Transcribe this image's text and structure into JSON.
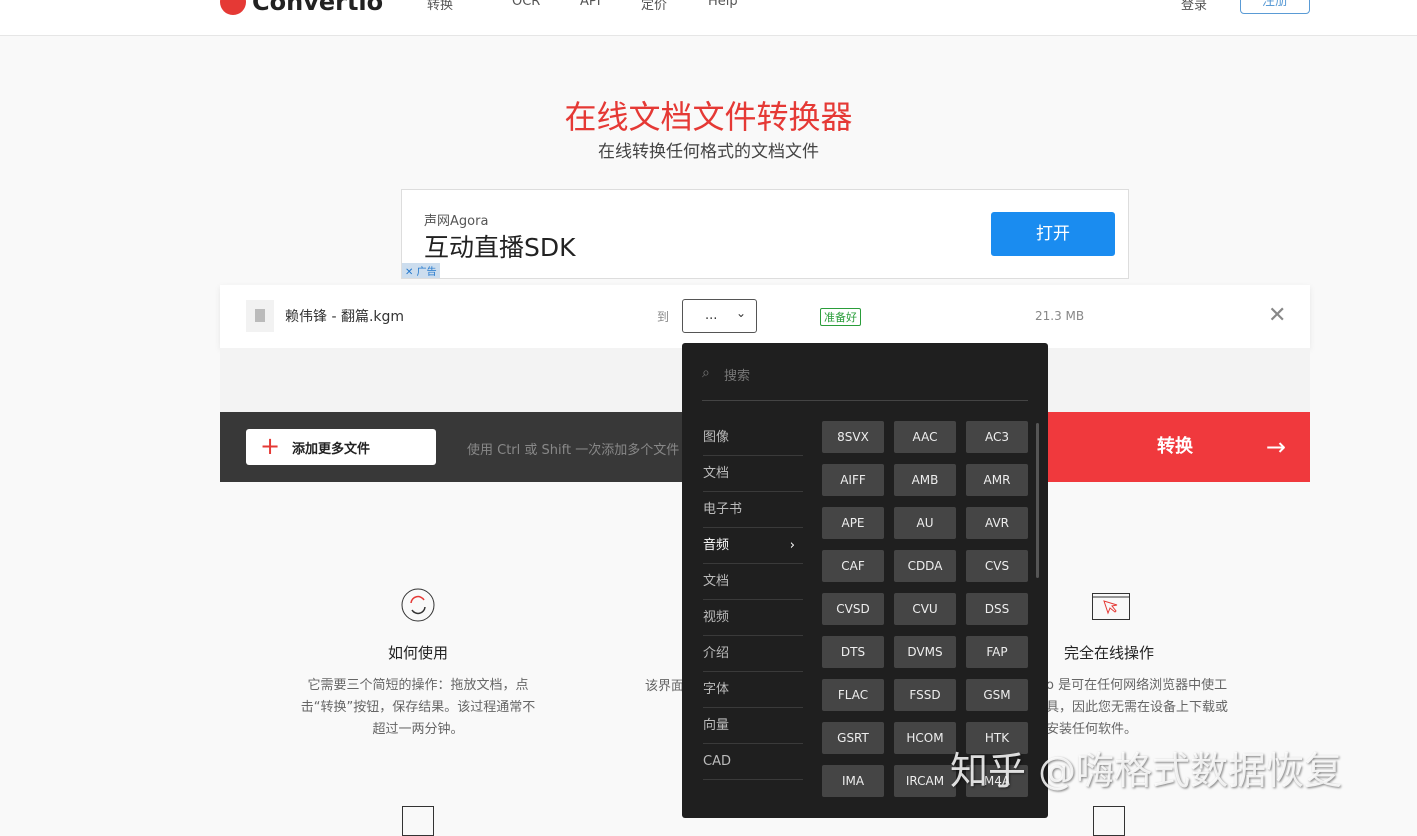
{
  "header": {
    "logo": "Convertio",
    "nav": [
      "转换",
      "OCR",
      "API",
      "定价",
      "Help"
    ],
    "login": "登录",
    "signup": "注册"
  },
  "hero": {
    "title": "在线文档文件转换器",
    "subtitle": "在线转换任何格式的文档文件"
  },
  "ad": {
    "brand": "声网Agora",
    "title": "互动直播SDK",
    "button": "打开",
    "tag": "广告"
  },
  "file": {
    "name": "赖伟锋 - 翻篇.kgm",
    "to": "到",
    "format": "...",
    "status": "准备好",
    "size": "21.3 MB"
  },
  "actions": {
    "add_more": "添加更多文件",
    "hint": "使用 Ctrl 或 Shift 一次添加多个文件",
    "convert": "转换"
  },
  "dropdown": {
    "search_placeholder": "搜索",
    "categories": [
      "图像",
      "文档",
      "电子书",
      "音频",
      "文档",
      "视频",
      "介绍",
      "字体",
      "向量",
      "CAD"
    ],
    "active_category": "音频",
    "formats": [
      "8SVX",
      "AAC",
      "AC3",
      "AIFF",
      "AMB",
      "AMR",
      "APE",
      "AU",
      "AVR",
      "CAF",
      "CDDA",
      "CVS",
      "CVSD",
      "CVU",
      "DSS",
      "DTS",
      "DVMS",
      "FAP",
      "FLAC",
      "FSSD",
      "GSM",
      "GSRT",
      "HCOM",
      "HTK",
      "IMA",
      "IRCAM",
      "M4A"
    ]
  },
  "features": [
    {
      "title": "如何使用",
      "text": "它需要三个简短的操作：拖放文档，点击“转换”按钮，保存结果。该过程通常不超过一两分钟。"
    },
    {
      "title": "",
      "text": "该界面"
    },
    {
      "title": "完全在线操作",
      "text": "o 是可在任何网络浏览器中使工具，因此您无需在设备上下载或安装任何软件。"
    }
  ],
  "watermark": "知乎 @嗨格式数据恢复",
  "colors": {
    "accent": "#e53935",
    "ad_button": "#1a8cf0",
    "dropdown_bg": "#1f1f1f"
  }
}
